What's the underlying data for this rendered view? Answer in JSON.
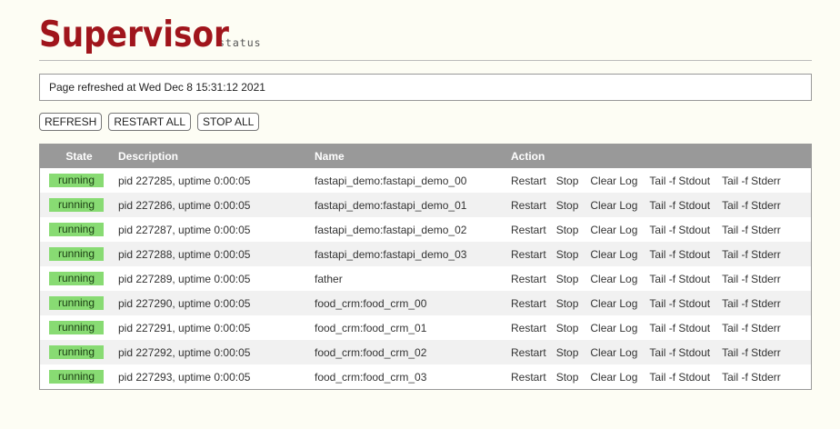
{
  "header": {
    "logo": "Supervisor",
    "subtitle": "status"
  },
  "refresh_message": "Page refreshed at Wed Dec 8 15:31:12 2021",
  "buttons": {
    "refresh": "REFRESH",
    "restart_all": "RESTART ALL",
    "stop_all": "STOP ALL"
  },
  "table": {
    "headers": {
      "state": "State",
      "description": "Description",
      "name": "Name",
      "action": "Action"
    },
    "action_labels": {
      "restart": "Restart",
      "stop": "Stop",
      "clear_log": "Clear Log",
      "tail_stdout": "Tail -f Stdout",
      "tail_stderr": "Tail -f Stderr"
    },
    "rows": [
      {
        "state": "running",
        "description": "pid 227285, uptime 0:00:05",
        "name": "fastapi_demo:fastapi_demo_00"
      },
      {
        "state": "running",
        "description": "pid 227286, uptime 0:00:05",
        "name": "fastapi_demo:fastapi_demo_01"
      },
      {
        "state": "running",
        "description": "pid 227287, uptime 0:00:05",
        "name": "fastapi_demo:fastapi_demo_02"
      },
      {
        "state": "running",
        "description": "pid 227288, uptime 0:00:05",
        "name": "fastapi_demo:fastapi_demo_03"
      },
      {
        "state": "running",
        "description": "pid 227289, uptime 0:00:05",
        "name": "father"
      },
      {
        "state": "running",
        "description": "pid 227290, uptime 0:00:05",
        "name": "food_crm:food_crm_00"
      },
      {
        "state": "running",
        "description": "pid 227291, uptime 0:00:05",
        "name": "food_crm:food_crm_01"
      },
      {
        "state": "running",
        "description": "pid 227292, uptime 0:00:05",
        "name": "food_crm:food_crm_02"
      },
      {
        "state": "running",
        "description": "pid 227293, uptime 0:00:05",
        "name": "food_crm:food_crm_03"
      }
    ]
  },
  "colors": {
    "brand": "#a0151c",
    "background": "#fdfdf4",
    "header_bg": "#999999",
    "status_running": "#88db73"
  }
}
